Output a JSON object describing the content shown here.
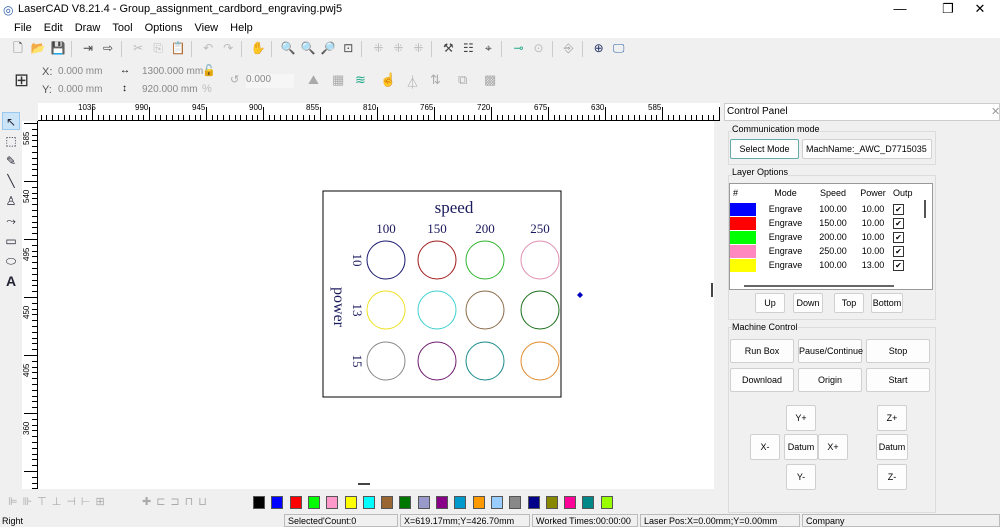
{
  "window": {
    "title": "LaserCAD V8.21.4 - Group_assignment_cardbord_engraving.pwj5",
    "minimize": "—",
    "maximize": "❐",
    "close": "✕"
  },
  "menu": [
    {
      "label": "File"
    },
    {
      "label": "Edit"
    },
    {
      "label": "Draw"
    },
    {
      "label": "Tool"
    },
    {
      "label": "Options"
    },
    {
      "label": "View"
    },
    {
      "label": "Help"
    }
  ],
  "toolbar2": {
    "x_label": "X:",
    "x_value": "0.000 mm",
    "y_label": "Y:",
    "y_value": "0.000 mm",
    "width_value": "1300.000 mm",
    "height_value": "920.000 mm",
    "percent": "%",
    "rotation": "0.000"
  },
  "ruler": {
    "h_ticks": [
      "1035",
      "990",
      "945",
      "900",
      "855",
      "810",
      "765",
      "720",
      "675",
      "630",
      "585"
    ],
    "v_ticks": [
      "585",
      "540",
      "495",
      "450",
      "405",
      "360"
    ]
  },
  "design": {
    "title": "speed",
    "speeds": [
      "100",
      "150",
      "200",
      "250"
    ],
    "power_label": "power",
    "powers": [
      "10",
      "13",
      "15"
    ],
    "circle_colors": [
      "#1a1a6e",
      "#a01c1c",
      "#2fb52f",
      "#e08fb0",
      "#f0e020",
      "#40d0d0",
      "#8b6a4a",
      "#1a6e1a",
      "#888888",
      "#6e1a6e",
      "#1a8a8a",
      "#e08a2a"
    ]
  },
  "panel": {
    "title": "Control Panel",
    "comm_title": "Communication mode",
    "select_mode": "Select Mode",
    "machine": "MachName:_AWC_D7715035",
    "layer_title": "Layer Options",
    "columns": [
      "#",
      "Mode",
      "Speed",
      "Power",
      "Outp"
    ],
    "layers": [
      {
        "color": "#0000ff",
        "mode": "Engrave",
        "speed": "100.00",
        "power": "10.00",
        "output": "✔"
      },
      {
        "color": "#ff0000",
        "mode": "Engrave",
        "speed": "150.00",
        "power": "10.00",
        "output": "✔"
      },
      {
        "color": "#00ff00",
        "mode": "Engrave",
        "speed": "200.00",
        "power": "10.00",
        "output": "✔"
      },
      {
        "color": "#ff88c0",
        "mode": "Engrave",
        "speed": "250.00",
        "power": "10.00",
        "output": "✔"
      },
      {
        "color": "#ffff00",
        "mode": "Engrave",
        "speed": "100.00",
        "power": "13.00",
        "output": "✔"
      }
    ],
    "layer_buttons": [
      "Up",
      "Down",
      "Top",
      "Bottom"
    ],
    "machine_title": "Machine Control",
    "machine_buttons": [
      "Run Box",
      "Pause/Continue",
      "Stop",
      "Download",
      "Origin",
      "Start"
    ],
    "jog": {
      "yplus": "Y+",
      "xminus": "X-",
      "datum": "Datum",
      "xplus": "X+",
      "yminus": "Y-",
      "zplus": "Z+",
      "zdatum": "Datum",
      "zminus": "Z-"
    }
  },
  "palette": [
    "#000000",
    "#0000ff",
    "#ff0000",
    "#00ff00",
    "#ff99cc",
    "#ffff00",
    "#00ffff",
    "#996633",
    "#007700",
    "#9999cc",
    "#880088",
    "#0099cc",
    "#ff9900",
    "#99ccff",
    "#888888",
    "#000088",
    "#888800",
    "#ff0099",
    "#008888",
    "#99ff00"
  ],
  "status": {
    "mode": "Right",
    "selected": "Selected'Count:0",
    "coords": "X=619.17mm;Y=426.70mm",
    "worked": "Worked Times:00:00:00",
    "laser": "Laser Pos:X=0.00mm;Y=0.00mm",
    "company": "Company"
  }
}
